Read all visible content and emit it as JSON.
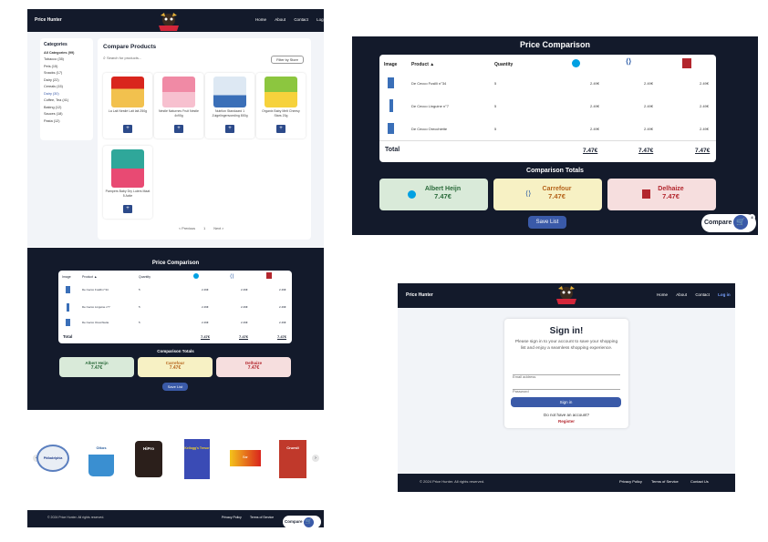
{
  "nav": {
    "brand": "Price Hunter",
    "links": [
      "Home",
      "About",
      "Contact",
      "Log in"
    ]
  },
  "categories": {
    "title": "Categories",
    "items": [
      "All Categories (99)",
      "Tobacco (35)",
      "Pets (15)",
      "Snacks (17)",
      "Dairy (22)",
      "Cereals (15)",
      "Dairy (30)",
      "Coffee, Tea (41)",
      "Baking (12)",
      "Sauces (18)",
      "Pasta (12)"
    ]
  },
  "compare": {
    "title": "Compare Products",
    "search_placeholder": "Search for products...",
    "filter_button": "Filter by Store",
    "products": [
      {
        "name": "La Lait Nestlé Lait lait 250g",
        "price": "2.49€"
      },
      {
        "name": "Nestlé Naturnes Fruit Nestle 4x90g",
        "price": "2.49€"
      },
      {
        "name": "Nutrilon Standaard 1 Zuigelingenvoeding 800g",
        "price": "2.49€"
      },
      {
        "name": "Organix Baby Melt Cheesy Stars 20g",
        "price": "2.49€"
      },
      {
        "name": "Pampers Baby Dry Luiers Maat 5 Actie",
        "price": "2.49€"
      }
    ],
    "pagination": {
      "prev": "< Previous",
      "page": "1",
      "next": "Next >"
    }
  },
  "price_comparison": {
    "title": "Price Comparison",
    "columns": [
      "Image",
      "Product ▲",
      "Quantity"
    ],
    "stores": [
      "Albert Heijn",
      "Carrefour",
      "Delhaize"
    ],
    "rows": [
      {
        "product": "De Cecco Fusilli n°34",
        "quantity": "5",
        "prices": [
          "2.49€",
          "2.49€",
          "2.49€"
        ]
      },
      {
        "product": "De Cecco Linguine n°7",
        "quantity": "5",
        "prices": [
          "2.49€",
          "2.49€",
          "2.49€"
        ]
      },
      {
        "product": "De Cecco Orecchiette",
        "quantity": "5",
        "prices": [
          "2.49€",
          "2.49€",
          "2.49€"
        ]
      }
    ],
    "total_label": "Total",
    "totals": [
      "7.47€",
      "7.47€",
      "7.47€"
    ],
    "totals_title": "Comparison Totals",
    "cards": [
      {
        "store": "Albert Heijn",
        "amount": "7.47€",
        "bg": "#d9ead9",
        "color": "#2a6a3a"
      },
      {
        "store": "Carrefour",
        "amount": "7.47€",
        "bg": "#f7f1c4",
        "color": "#b5631a"
      },
      {
        "store": "Delhaize",
        "amount": "7.47€",
        "bg": "#f6dede",
        "color": "#b3262d"
      }
    ],
    "save_button": "Save List",
    "compare_button": "Compare",
    "cart_count": "4"
  },
  "shelf": [
    "Philadelphia",
    "Oikos",
    "HiPro",
    "Kellogg's Tresor",
    "Bar",
    "Cruesli"
  ],
  "footer": {
    "copyright": "© 2024 Price Hunter. All rights reserved.",
    "links": [
      "Privacy Policy",
      "Terms of Service",
      "Contact Us"
    ]
  },
  "signin": {
    "title": "Sign in!",
    "subtitle": "Please sign in to your account to save your shopping list and enjoy a seamless shopping experience.",
    "email_placeholder": "Email address",
    "password_placeholder": "Password",
    "button": "Sign in",
    "no_account": "Do not have an account?",
    "register": "Register"
  },
  "colors": {
    "navy": "#131a2b",
    "accent": "#3a5aa8",
    "ah": "#00a0e2",
    "carrefour": "#1b4fa0",
    "delhaize": "#b3262d"
  }
}
